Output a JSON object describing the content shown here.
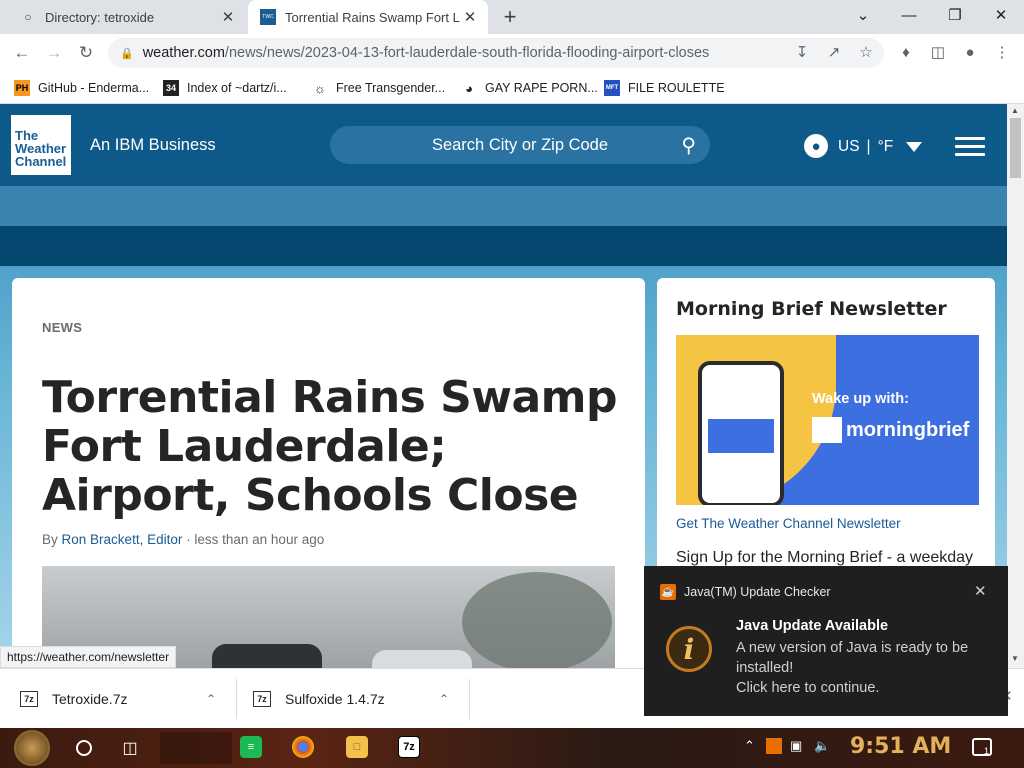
{
  "browser": {
    "tabs": [
      {
        "title": "Directory: tetroxide",
        "active": false
      },
      {
        "title": "Torrential Rains Swamp Fort Lau",
        "active": true
      }
    ],
    "url_host": "weather.com",
    "url_path": "/news/news/2023-04-13-fort-lauderdale-south-florida-flooding-airport-closes",
    "bookmarks": [
      {
        "label": "GitHub - Enderma...",
        "icon": "PH"
      },
      {
        "label": "Index of ~dartz/i...",
        "icon": "34"
      },
      {
        "label": "Free Transgender...",
        "icon": "globe-icon"
      },
      {
        "label": "GAY RAPE PORN...",
        "icon": "globe-icon"
      },
      {
        "label": "FILE ROULETTE",
        "icon": "MFT"
      }
    ],
    "status_url": "https://weather.com/newsletter"
  },
  "site": {
    "logo": "The Weather Channel",
    "logo_lines": [
      "The",
      "Weather",
      "Channel"
    ],
    "tagline": "An IBM Business",
    "search_placeholder": "Search City or Zip Code",
    "locale_country": "US",
    "locale_unit": "°F"
  },
  "article": {
    "kicker": "NEWS",
    "headline": "Torrential Rains Swamp Fort Lauderdale; Airport, Schools Close",
    "byline_prefix": "By",
    "author": "Ron Brackett, Editor",
    "time": "less than an hour ago"
  },
  "sidebar": {
    "title": "Morning Brief Newsletter",
    "promo_text": "Wake up with:",
    "promo_brand": "morningbrief",
    "link": "Get The Weather Channel Newsletter",
    "description": "Sign Up for the Morning Brief - a weekday"
  },
  "downloads": [
    {
      "name": "Tetroxide.7z",
      "icon": "7z"
    },
    {
      "name": "Sulfoxide 1.4.7z",
      "icon": "7z"
    }
  ],
  "toast": {
    "app": "Java(TM) Update Checker",
    "title": "Java Update Available",
    "body_line1": "A new version of Java is ready to be installed!",
    "body_line2": "Click here to continue."
  },
  "taskbar": {
    "time": "9:51 AM",
    "tray_badge": "1"
  },
  "colors": {
    "twc_header": "#0d5a8a",
    "link": "#1a5a96",
    "toast_bg": "#1f1f1f"
  }
}
